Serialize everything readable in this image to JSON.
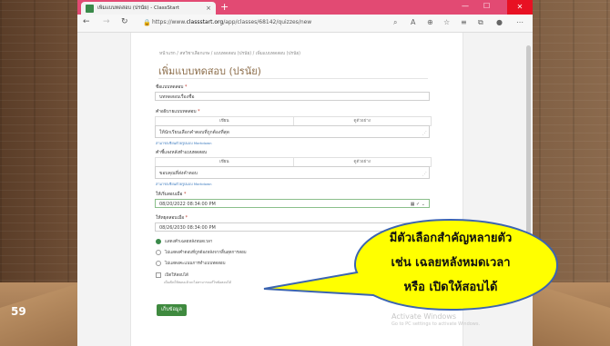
{
  "slide": {
    "number": "59"
  },
  "browser": {
    "tab_title": "เพิ่มแบบทดสอบ (ปรนัย) - ClassStart",
    "tab_close": "×",
    "new_tab": "+",
    "url_prefix": "https://www.",
    "url_host": "classstart.org",
    "url_path": "/app/classes/68142/quizzes/new"
  },
  "page": {
    "breadcrumb": "หน้าแรก  /  สหวิชาเลือกเกษ  /  แบบทดสอบ (ปรนัย)  /  เพิ่มแบบทดสอบ (ปรนัย)",
    "title": "เพิ่มแบบทดสอบ (ปรนัย)",
    "name_label": "ชื่อแบบทดสอบ",
    "name_value": "บททดสอบเรื่องชื่อ",
    "desc_label": "คำอธิบายแบบทดสอบ",
    "tab_write": "เขียน",
    "tab_preview": "ดูตัวอย่าง",
    "desc_value": "ให้นักเรียนเลือกคำตอบที่ถูกต้องที่สุด",
    "markdown_note": "สามารถเขียนด้วยรูปแบบ Markdown",
    "after_label": "คำชี้แจงหลังทำแบบทดสอบ",
    "after_value": "ขอบคุณที่ส่งคำตอบ",
    "open_label": "ให้เริ่มสอบเมื่อ",
    "open_value": "08/20/2022 08:34:00 PM",
    "close_label": "ให้หยุดสอบเมื่อ",
    "close_value": "08/26/2030 08:34:00 PM",
    "options": [
      "แสดงคำเฉลยหลังหมดเวลา",
      "ไม่แสดงคำตอบที่ถูกต้องหลังจากสิ้นสุดการสอบ",
      "ไม่แสดงคะแนนการทำแบบทดสอบ"
    ],
    "checkbox_label": "เปิดให้สอบได้",
    "checkbox_note": "เมื่อเปิดให้สอบแล้วจะไม่สามารถแก้ไขข้อสอบได้",
    "save_button": "เก็บข้อมูล",
    "watermark_title": "Activate Windows",
    "watermark_sub": "Go to PC settings to activate Windows."
  },
  "callout": {
    "line1": "มีตัวเลือกสำคัญหลายตัว",
    "line2": "เช่น เฉลยหลังหมดเวลา",
    "line3": "หรือ เปิดให้สอบได้",
    "fill": "#ffff00",
    "stroke": "#3b64b0"
  }
}
